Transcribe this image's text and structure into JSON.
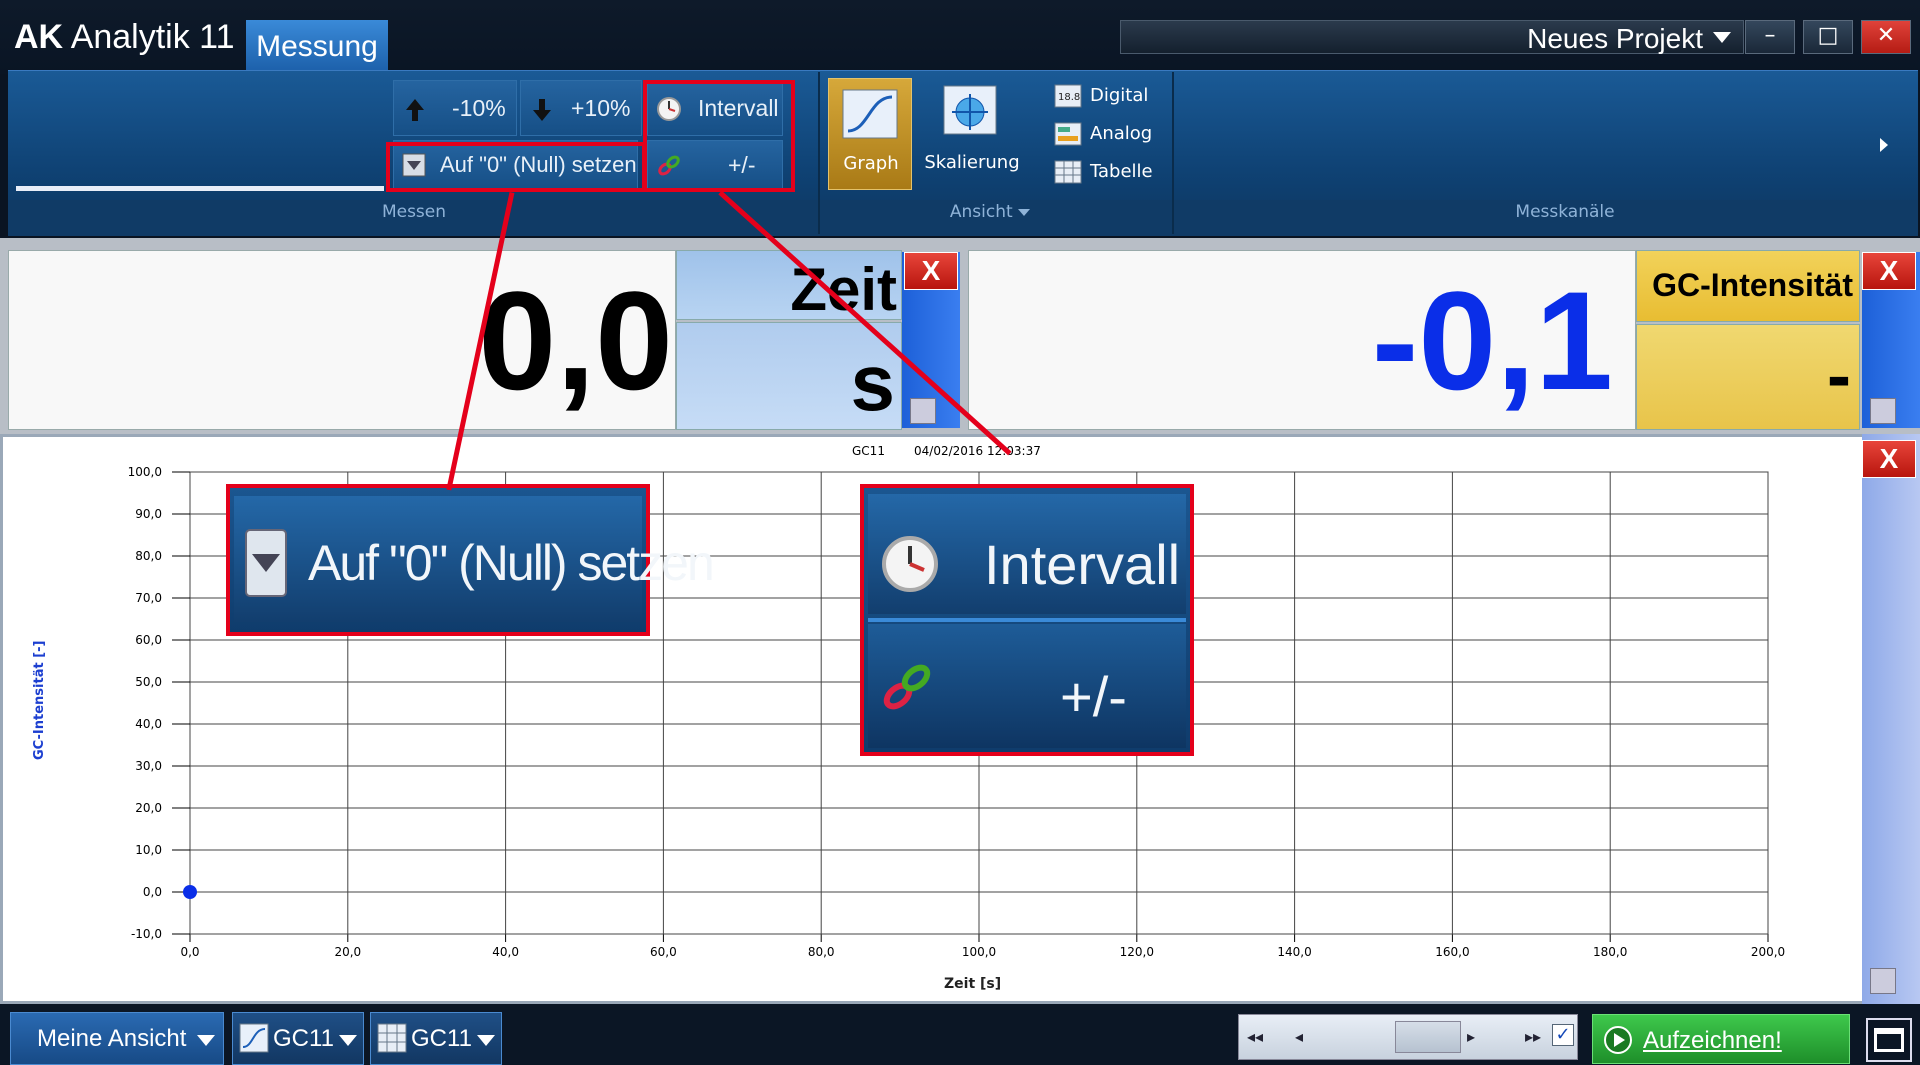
{
  "titlebar": {
    "app_name_bold": "AK",
    "app_name_rest": "Analytik 11",
    "tab_active": "Messung",
    "project": "Neues Projekt",
    "minimize_label": "–",
    "maximize_label": "□",
    "close_label": "✕"
  },
  "ribbon": {
    "minus10": "-10%",
    "plus10": "+10%",
    "interval": "Intervall",
    "zero": "Auf \"0\" (Null) setzen",
    "zero_short": "Auf \"0\" (Null) setzen",
    "plusminus": "+/-",
    "graph": "Graph",
    "scaling": "Skalierung",
    "digital": "Digital",
    "analog": "Analog",
    "table": "Tabelle",
    "group_messen": "Messen",
    "group_ansicht": "Ansicht",
    "group_messkanaele": "Messkanäle"
  },
  "displays": {
    "left": {
      "value": "0,0",
      "name": "Zeit",
      "unit": "s",
      "color": "#000000"
    },
    "right": {
      "value": "-0,1",
      "name": "GC-Intensität",
      "unit": "-",
      "color": "#0a2ee8"
    },
    "close_label": "X"
  },
  "graph": {
    "header_name": "GC11",
    "header_date": "04/02/2016 12:03:37",
    "xlabel": "Zeit [s]",
    "ylabel": "GC-Intensität [-]",
    "close_label": "X"
  },
  "chart_data": {
    "type": "scatter",
    "title": "GC11",
    "xlabel": "Zeit [s]",
    "ylabel": "GC-Intensität [-]",
    "xlim": [
      0,
      200
    ],
    "ylim": [
      -10,
      100
    ],
    "x_ticks": [
      "0,0",
      "20,0",
      "40,0",
      "60,0",
      "80,0",
      "100,0",
      "120,0",
      "140,0",
      "160,0",
      "180,0",
      "200,0"
    ],
    "y_ticks": [
      "-10,0",
      "0,0",
      "10,0",
      "20,0",
      "30,0",
      "40,0",
      "50,0",
      "60,0",
      "70,0",
      "80,0",
      "90,0",
      "100,0"
    ],
    "grid": true,
    "series": [
      {
        "x": [
          0
        ],
        "y": [
          0
        ],
        "color": "#0a2ee8"
      }
    ]
  },
  "zoom_callouts": {
    "left": "Auf \"0\" (Null) setzen",
    "right_top": "Intervall",
    "right_bottom": "+/-"
  },
  "bottombar": {
    "view": "Meine Ansicht",
    "chip1": "GC11",
    "chip2": "GC11",
    "record": "Aufzeichnen!"
  },
  "colors": {
    "accent_red": "#e4001b",
    "record_green": "#2bab3a"
  }
}
